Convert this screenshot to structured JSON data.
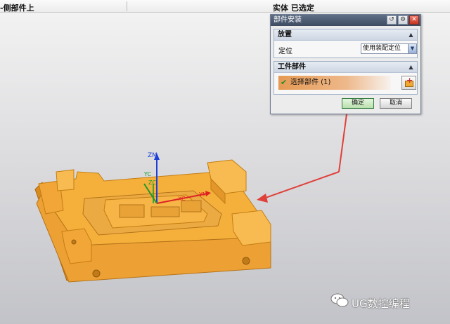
{
  "topbar": {
    "left_text": "-侧部件上",
    "right_text": "实体  已选定"
  },
  "dialog": {
    "title": "部件安装",
    "section1": {
      "title": "放置",
      "label": "定位",
      "select_value": "使用装配定位"
    },
    "section2": {
      "title": "工件部件",
      "select_text": "选择部件 (1)"
    },
    "ok_label": "确定",
    "cancel_label": "取消"
  },
  "axes": {
    "z_label": "ZM",
    "y_label": "YM",
    "yc_label": "YC",
    "xc_label": "XC",
    "zc_label": "ZC"
  },
  "watermark": "UG数控编程",
  "colors": {
    "part_fill": "#f5b03c",
    "part_edge": "#c47d12",
    "arrow": "#e0403a",
    "axis_z": "#1d3fd6",
    "axis_x": "#d22",
    "axis_y": "#1a9a2a"
  }
}
